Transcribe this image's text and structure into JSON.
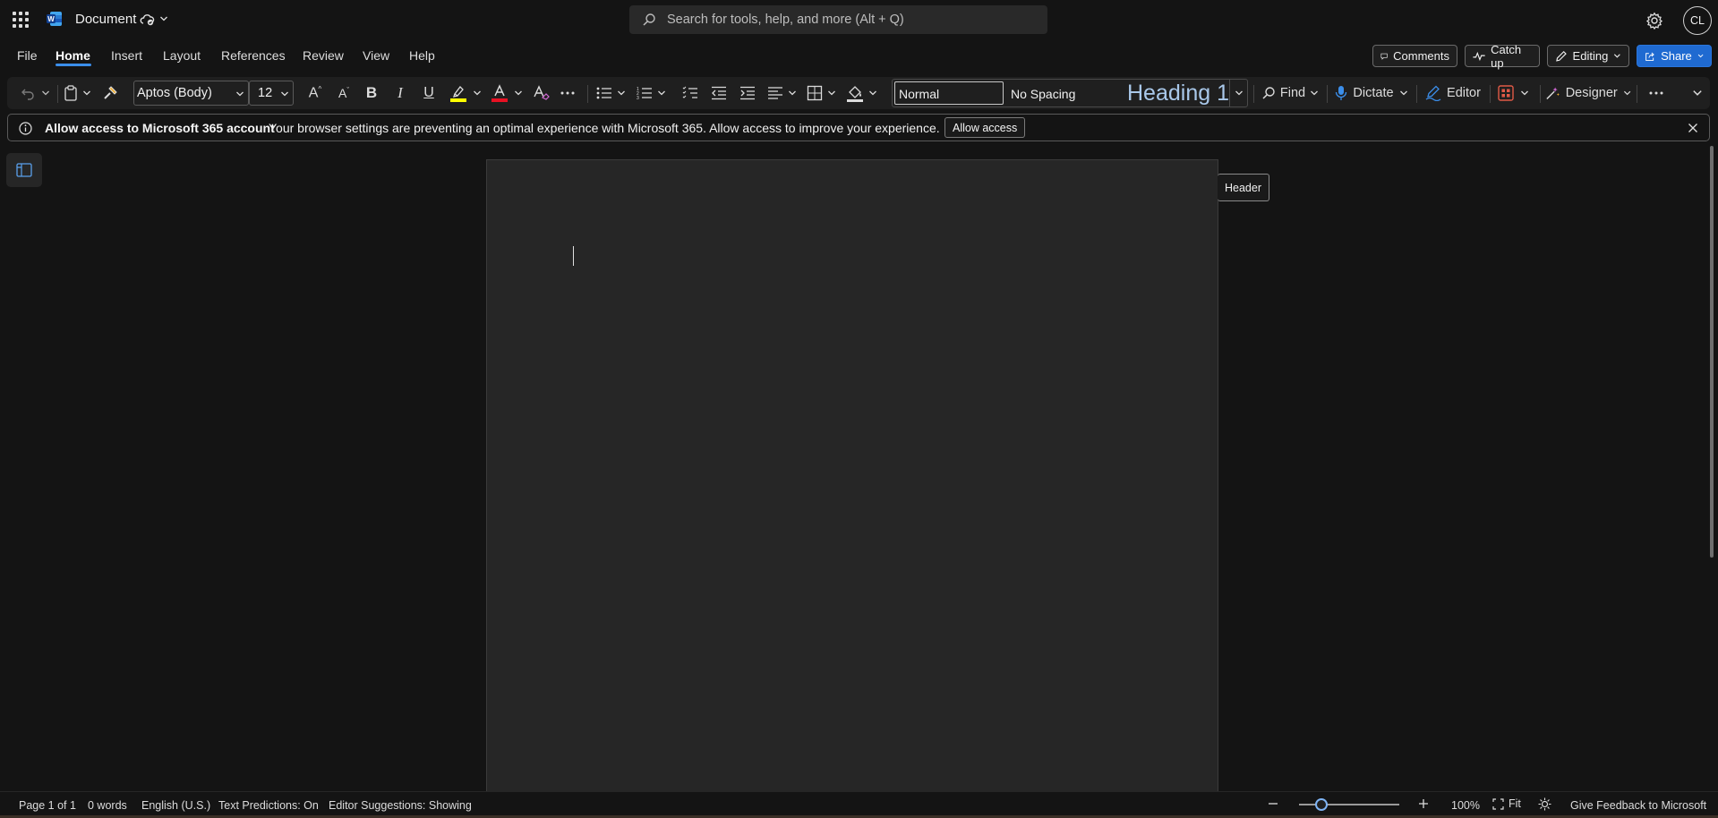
{
  "app": {
    "document_title": "Document",
    "search_placeholder": "Search for tools, help, and more (Alt + Q)",
    "user_initials": "CL"
  },
  "menu": {
    "tabs": [
      "File",
      "Home",
      "Insert",
      "Layout",
      "References",
      "Review",
      "View",
      "Help"
    ],
    "active_tab": "Home",
    "comments_label": "Comments",
    "catchup_label": "Catch up",
    "editing_label": "Editing",
    "share_label": "Share"
  },
  "ribbon": {
    "font_name": "Aptos (Body)",
    "font_size": "12",
    "styles": {
      "normal": "Normal",
      "no_spacing": "No Spacing",
      "heading1": "Heading 1"
    },
    "find_label": "Find",
    "dictate_label": "Dictate",
    "editor_label": "Editor",
    "designer_label": "Designer",
    "highlight_color": "#ffff00",
    "font_color": "#e81123"
  },
  "infobar": {
    "title": "Allow access to Microsoft 365 account",
    "message": "Your browser settings are preventing an optimal experience with Microsoft 365. Allow access to improve your experience.",
    "button_label": "Allow access"
  },
  "canvas": {
    "header_label": "Header"
  },
  "status": {
    "page": "Page 1 of 1",
    "words": "0 words",
    "language": "English (U.S.)",
    "predictions": "Text Predictions: On",
    "editor_suggestions": "Editor Suggestions: Showing",
    "zoom": "100%",
    "fit_label": "Fit",
    "feedback": "Give Feedback to Microsoft"
  },
  "icons": [
    "app-launcher-icon",
    "word-logo-icon",
    "cloud-saved-icon",
    "search-icon",
    "gear-icon",
    "undo-icon",
    "paste-icon",
    "format-painter-icon",
    "bold-icon",
    "italic-icon",
    "underline-icon",
    "highlight-icon",
    "font-color-icon",
    "clear-format-icon",
    "bullets-icon",
    "numbering-icon",
    "multilevel-list-icon",
    "decrease-indent-icon",
    "increase-indent-icon",
    "align-icon",
    "borders-icon",
    "shading-icon",
    "magnifier-icon",
    "microphone-icon",
    "editor-pen-icon",
    "add-ins-icon",
    "designer-icon",
    "info-icon",
    "close-icon",
    "nav-pane-icon",
    "focus-icon"
  ]
}
